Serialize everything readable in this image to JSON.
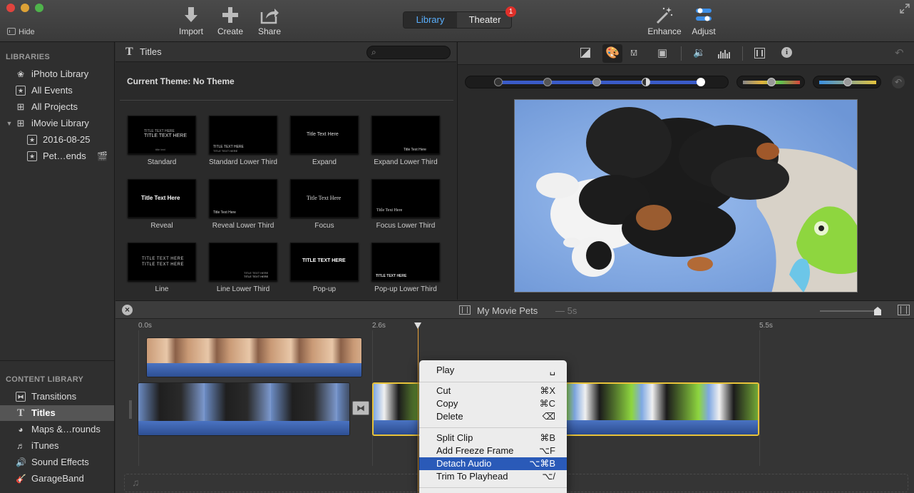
{
  "toolbar": {
    "hide_label": "Hide",
    "import_label": "Import",
    "create_label": "Create",
    "share_label": "Share",
    "library_tab": "Library",
    "theater_tab": "Theater",
    "theater_badge": "1",
    "enhance_label": "Enhance",
    "adjust_label": "Adjust"
  },
  "sidebar": {
    "libraries_header": "LIBRARIES",
    "libraries": [
      {
        "label": "iPhoto Library",
        "icon": "iphoto-icon"
      },
      {
        "label": "All Events",
        "icon": "star-icon"
      },
      {
        "label": "All Projects",
        "icon": "grid-icon"
      },
      {
        "label": "iMovie Library",
        "icon": "grid-icon"
      },
      {
        "label": "2016-08-25",
        "icon": "star-icon"
      },
      {
        "label": "Pet…ends",
        "icon": "star-icon"
      }
    ],
    "content_header": "CONTENT LIBRARY",
    "content": [
      {
        "label": "Transitions",
        "icon": "transitions-icon"
      },
      {
        "label": "Titles",
        "icon": "titles-icon"
      },
      {
        "label": "Maps &…rounds",
        "icon": "globe-icon"
      },
      {
        "label": "iTunes",
        "icon": "music-note-icon"
      },
      {
        "label": "Sound Effects",
        "icon": "speaker-icon"
      },
      {
        "label": "GarageBand",
        "icon": "guitar-icon"
      }
    ]
  },
  "browser": {
    "title": "Titles",
    "search_placeholder": "",
    "theme_text": "Current Theme: No Theme",
    "titles": [
      {
        "label": "Standard",
        "preview": "TITLE TEXT HERE"
      },
      {
        "label": "Standard Lower Third",
        "preview": "TITLE TEXT HERE"
      },
      {
        "label": "Expand",
        "preview": "Title Text Here"
      },
      {
        "label": "Expand Lower Third",
        "preview": "Title Text Here"
      },
      {
        "label": "Reveal",
        "preview": "Title Text Here"
      },
      {
        "label": "Reveal Lower Third",
        "preview": "Title Text Here"
      },
      {
        "label": "Focus",
        "preview": "Title Text Here"
      },
      {
        "label": "Focus Lower Third",
        "preview": "Title Text Here"
      },
      {
        "label": "Line",
        "preview": "TITLE TEXT HERE"
      },
      {
        "label": "Line Lower Third",
        "preview": "TITLE TEXT HERE"
      },
      {
        "label": "Pop-up",
        "preview": "TITLE TEXT HERE"
      },
      {
        "label": "Pop-up Lower Third",
        "preview": "TITLE TEXT HERE"
      }
    ]
  },
  "timeline": {
    "project_name": "My Movie Pets",
    "duration": "— 5s",
    "ruler": [
      "0.0s",
      "2.6s",
      "5.5s"
    ]
  },
  "context_menu": {
    "items": [
      {
        "label": "Play",
        "shortcut": "␣"
      },
      {
        "label": "Cut",
        "shortcut": "⌘X"
      },
      {
        "label": "Copy",
        "shortcut": "⌘C"
      },
      {
        "label": "Delete",
        "shortcut": "⌫"
      },
      {
        "label": "Split Clip",
        "shortcut": "⌘B"
      },
      {
        "label": "Add Freeze Frame",
        "shortcut": "⌥F"
      },
      {
        "label": "Detach Audio",
        "shortcut": "⌥⌘B"
      },
      {
        "label": "Trim To Playhead",
        "shortcut": "⌥/"
      }
    ],
    "highlighted": "Detach Audio"
  },
  "colors": {
    "accent": "#2f7fd8",
    "highlight": "#2a5ab8",
    "clip_selected": "#e8c33a",
    "playhead": "#e8a23a"
  }
}
